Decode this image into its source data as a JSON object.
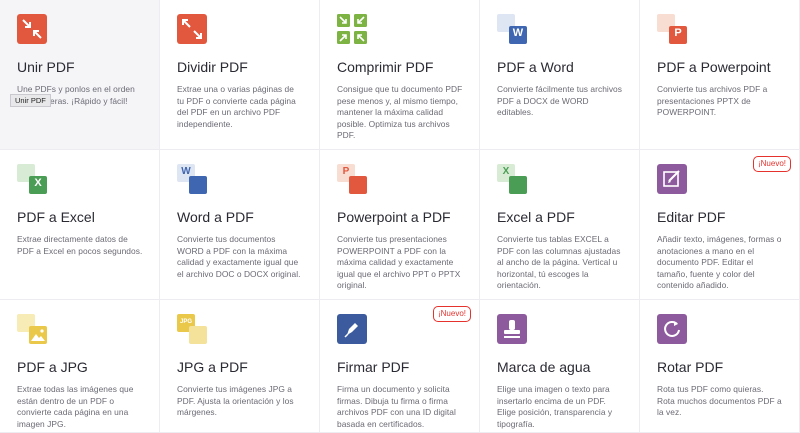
{
  "tooltip": "Unir PDF",
  "badge_new": "¡Nuevo!",
  "colors": {
    "red": "#e5322d",
    "green": "#7fba00",
    "excel": "#2d8a4e",
    "word": "#2a5699",
    "ppt": "#d24726",
    "purple": "#9b59b6",
    "jpg": "#f0c419",
    "sign": "#4a5aa8",
    "watermark": "#8e5a9e",
    "rotate": "#9b59b6"
  },
  "tools": [
    {
      "title": "Unir PDF",
      "desc": "Une PDFs y ponlos en el orden que prefieras. ¡Rápido y fácil!",
      "icon": "merge-icon"
    },
    {
      "title": "Dividir PDF",
      "desc": "Extrae una o varias páginas de tu PDF o convierte cada página del PDF en un archivo PDF independiente.",
      "icon": "split-icon"
    },
    {
      "title": "Comprimir PDF",
      "desc": "Consigue que tu documento PDF pese menos y, al mismo tiempo, mantener la máxima calidad posible. Optimiza tus archivos PDF.",
      "icon": "compress-icon"
    },
    {
      "title": "PDF a Word",
      "desc": "Convierte fácilmente tus archivos PDF a DOCX de WORD editables.",
      "icon": "pdf-to-word-icon"
    },
    {
      "title": "PDF a Powerpoint",
      "desc": "Convierte tus archivos PDF a presentaciones PPTX de POWERPOINT.",
      "icon": "pdf-to-ppt-icon"
    },
    {
      "title": "PDF a Excel",
      "desc": "Extrae directamente datos de PDF a Excel en pocos segundos.",
      "icon": "pdf-to-excel-icon"
    },
    {
      "title": "Word a PDF",
      "desc": "Convierte tus documentos WORD a PDF con la máxima calidad y exactamente igual que el archivo DOC o DOCX original.",
      "icon": "word-to-pdf-icon"
    },
    {
      "title": "Powerpoint a PDF",
      "desc": "Convierte tus presentaciones POWERPOINT a PDF con la máxima calidad y exactamente igual que el archivo PPT o PPTX original.",
      "icon": "ppt-to-pdf-icon"
    },
    {
      "title": "Excel a PDF",
      "desc": "Convierte tus tablas EXCEL a PDF con las columnas ajustadas al ancho de la página. Vertical u horizontal, tú escoges la orientación.",
      "icon": "excel-to-pdf-icon"
    },
    {
      "title": "Editar PDF",
      "desc": "Añadir texto, imágenes, formas o anotaciones a mano en el documento PDF. Editar el tamaño, fuente y color del contenido añadido.",
      "icon": "edit-pdf-icon",
      "badge": true
    },
    {
      "title": "PDF a JPG",
      "desc": "Extrae todas las imágenes que están dentro de un PDF o convierte cada página en una imagen JPG.",
      "icon": "pdf-to-jpg-icon"
    },
    {
      "title": "JPG a PDF",
      "desc": "Convierte tus imágenes JPG a PDF. Ajusta la orientación y los márgenes.",
      "icon": "jpg-to-pdf-icon"
    },
    {
      "title": "Firmar PDF",
      "desc": "Firma un documento y solicita firmas. Dibuja tu firma o firma archivos PDF con una ID digital basada en certificados.",
      "icon": "sign-pdf-icon",
      "badge": true
    },
    {
      "title": "Marca de agua",
      "desc": "Elige una imagen o texto para insertarlo encima de un PDF. Elige posición, transparencia y tipografía.",
      "icon": "watermark-icon"
    },
    {
      "title": "Rotar PDF",
      "desc": "Rota tus PDF como quieras. Rota muchos documentos PDF a la vez.",
      "icon": "rotate-pdf-icon"
    }
  ],
  "icon_letters": {
    "word": "W",
    "ppt": "P",
    "excel": "X",
    "jpg": "JPG"
  }
}
